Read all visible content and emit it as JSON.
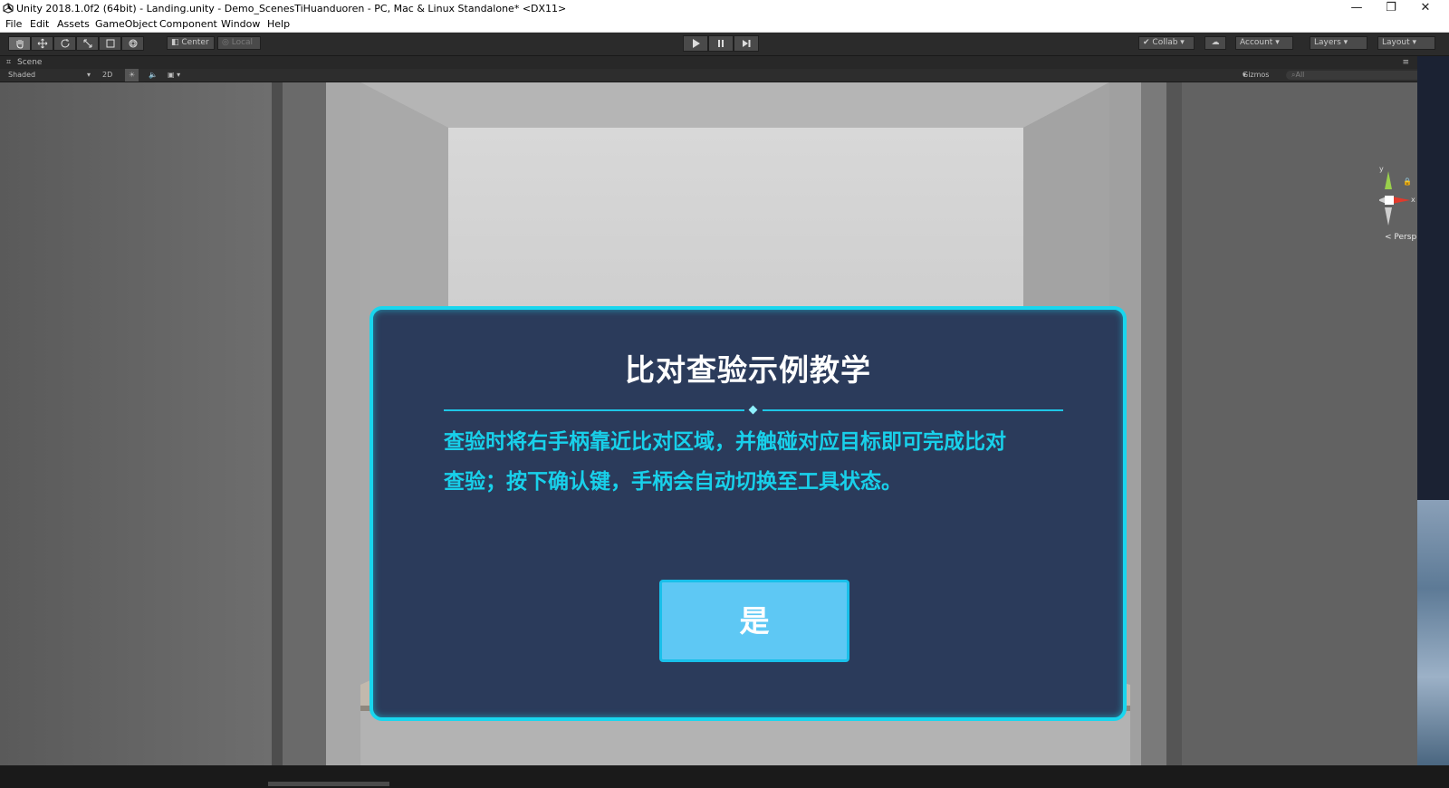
{
  "window": {
    "title": "Unity 2018.1.0f2 (64bit) - Landing.unity - Demo_ScenesTiHuanduoren - PC, Mac & Linux Standalone* <DX11>",
    "controls": [
      "—",
      "❐",
      "✕"
    ]
  },
  "menu": [
    "File",
    "Edit",
    "Assets",
    "GameObject",
    "Component",
    "Window",
    "Help"
  ],
  "toolbar": {
    "pivot_label": "Center",
    "space_label": "Local",
    "collab_label": "Collab",
    "account_label": "Account",
    "layers_label": "Layers",
    "layout_label": "Layout"
  },
  "scene": {
    "tab_label": "Scene",
    "shading_label": "Shaded",
    "mode_2d": "2D",
    "gizmos_label": "Gizmos",
    "search_placeholder": "All",
    "persp_label": "Persp",
    "axis_y": "y",
    "axis_x": "x"
  },
  "dialog": {
    "title": "比对查验示例教学",
    "body_line1": "查验时将右手柄靠近比对区域，并触碰对应目标即可完成比对",
    "body_line2": "查验；按下确认键，手柄会自动切换至工具状态。",
    "confirm_label": "是",
    "accent_color": "#19d6ee"
  }
}
